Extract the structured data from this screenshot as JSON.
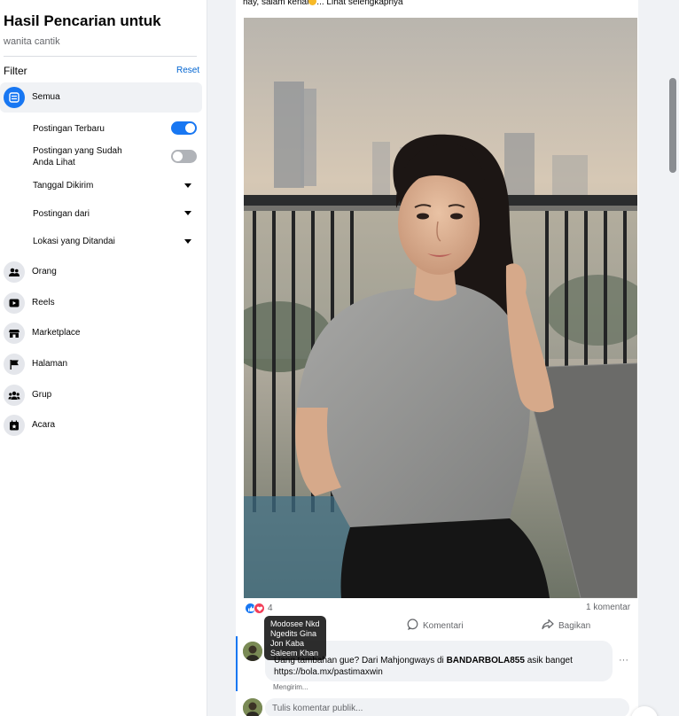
{
  "sidebar": {
    "title": "Hasil Pencarian untuk",
    "query": "wanita cantik",
    "filter_label": "Filter",
    "reset_label": "Reset",
    "active": {
      "label": "Semua",
      "icon": "feed-icon"
    },
    "sub_filters": [
      {
        "label": "Postingan Terbaru",
        "control": "toggle",
        "state": "on"
      },
      {
        "label": "Postingan yang Sudah Anda Lihat",
        "control": "toggle",
        "state": "off"
      },
      {
        "label": "Tanggal Dikirim",
        "control": "dropdown"
      },
      {
        "label": "Postingan dari",
        "control": "dropdown"
      },
      {
        "label": "Lokasi yang Ditandai",
        "control": "dropdown"
      }
    ],
    "categories": [
      {
        "label": "Orang",
        "icon": "people-icon"
      },
      {
        "label": "Reels",
        "icon": "reels-icon"
      },
      {
        "label": "Marketplace",
        "icon": "marketplace-icon"
      },
      {
        "label": "Halaman",
        "icon": "flag-icon"
      },
      {
        "label": "Grup",
        "icon": "groups-icon"
      },
      {
        "label": "Acara",
        "icon": "calendar-icon"
      }
    ]
  },
  "post": {
    "text_prefix": "hay, salam kenal",
    "text_more": "... Lihat selengkapnya",
    "reaction_count": "4",
    "comment_count": "1 komentar",
    "actions": {
      "comment": "Komentari",
      "share": "Bagikan"
    },
    "reactors": [
      "Modosee Nkd",
      "Ngedits Gina",
      "Jon Kaba",
      "Saleem Khan"
    ],
    "comment": {
      "text_start": "Uang tambahan gue? Dari Mahjongways di ",
      "text_bold": "BANDARBOLA855",
      "text_end": " asik banget https://bola.mx/pastimaxwin",
      "status": "Mengirim..."
    },
    "write_placeholder": "Tulis komentar publik..."
  },
  "colors": {
    "accent": "#1877f2",
    "link": "#0064d1",
    "love": "#f33e58",
    "muted_text": "#65676b"
  }
}
